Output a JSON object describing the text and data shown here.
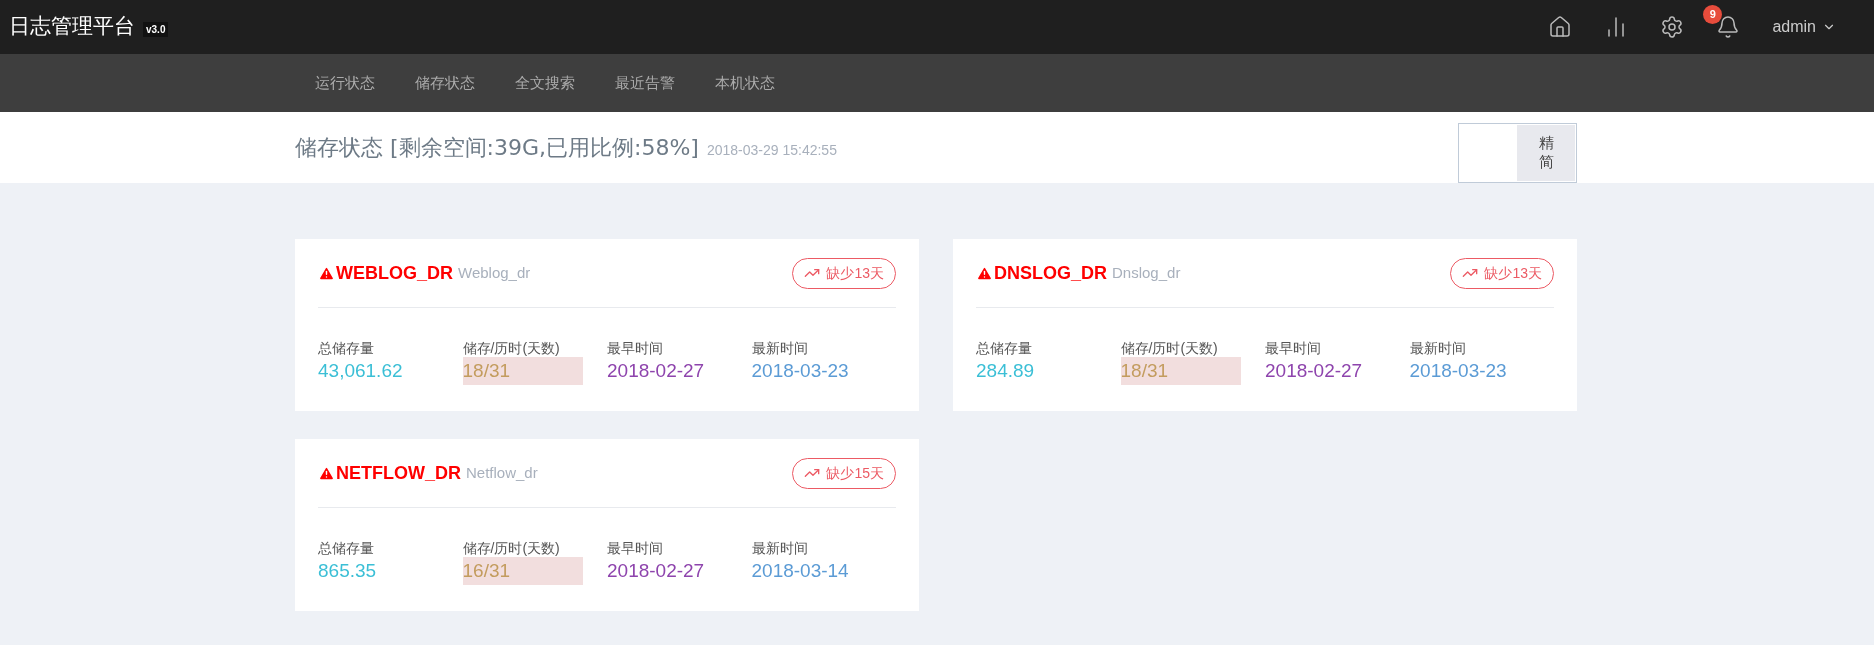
{
  "brand": {
    "title": "日志管理平台",
    "version": "v3.0"
  },
  "topbar": {
    "notification_count": "9",
    "user": "admin"
  },
  "nav": [
    {
      "label": "运行状态",
      "selected": false
    },
    {
      "label": "储存状态",
      "selected": false
    },
    {
      "label": "全文搜索",
      "selected": false
    },
    {
      "label": "最近告警",
      "selected": false
    },
    {
      "label": "本机状态",
      "selected": false
    }
  ],
  "page_header": {
    "title": "储存状态 [剩余空间:39G,已用比例:58%]",
    "timestamp": "2018-03-29 15:42:55",
    "toggle_label": "精简"
  },
  "cards": [
    {
      "name": "WEBLOG_DR",
      "alias": "Weblog_dr",
      "badge": "缺少13天",
      "stats": [
        {
          "label": "总储存量",
          "value": "43,061.62"
        },
        {
          "label": "储存/历时(天数)",
          "value": "18/31"
        },
        {
          "label": "最早时间",
          "value": "2018-02-27"
        },
        {
          "label": "最新时间",
          "value": "2018-03-23"
        }
      ]
    },
    {
      "name": "DNSLOG_DR",
      "alias": "Dnslog_dr",
      "badge": "缺少13天",
      "stats": [
        {
          "label": "总储存量",
          "value": "284.89"
        },
        {
          "label": "储存/历时(天数)",
          "value": "18/31"
        },
        {
          "label": "最早时间",
          "value": "2018-02-27"
        },
        {
          "label": "最新时间",
          "value": "2018-03-23"
        }
      ]
    },
    {
      "name": "NETFLOW_DR",
      "alias": "Netflow_dr",
      "badge": "缺少15天",
      "stats": [
        {
          "label": "总储存量",
          "value": "865.35"
        },
        {
          "label": "储存/历时(天数)",
          "value": "16/31"
        },
        {
          "label": "最早时间",
          "value": "2018-02-27"
        },
        {
          "label": "最新时间",
          "value": "2018-03-14"
        }
      ]
    }
  ]
}
